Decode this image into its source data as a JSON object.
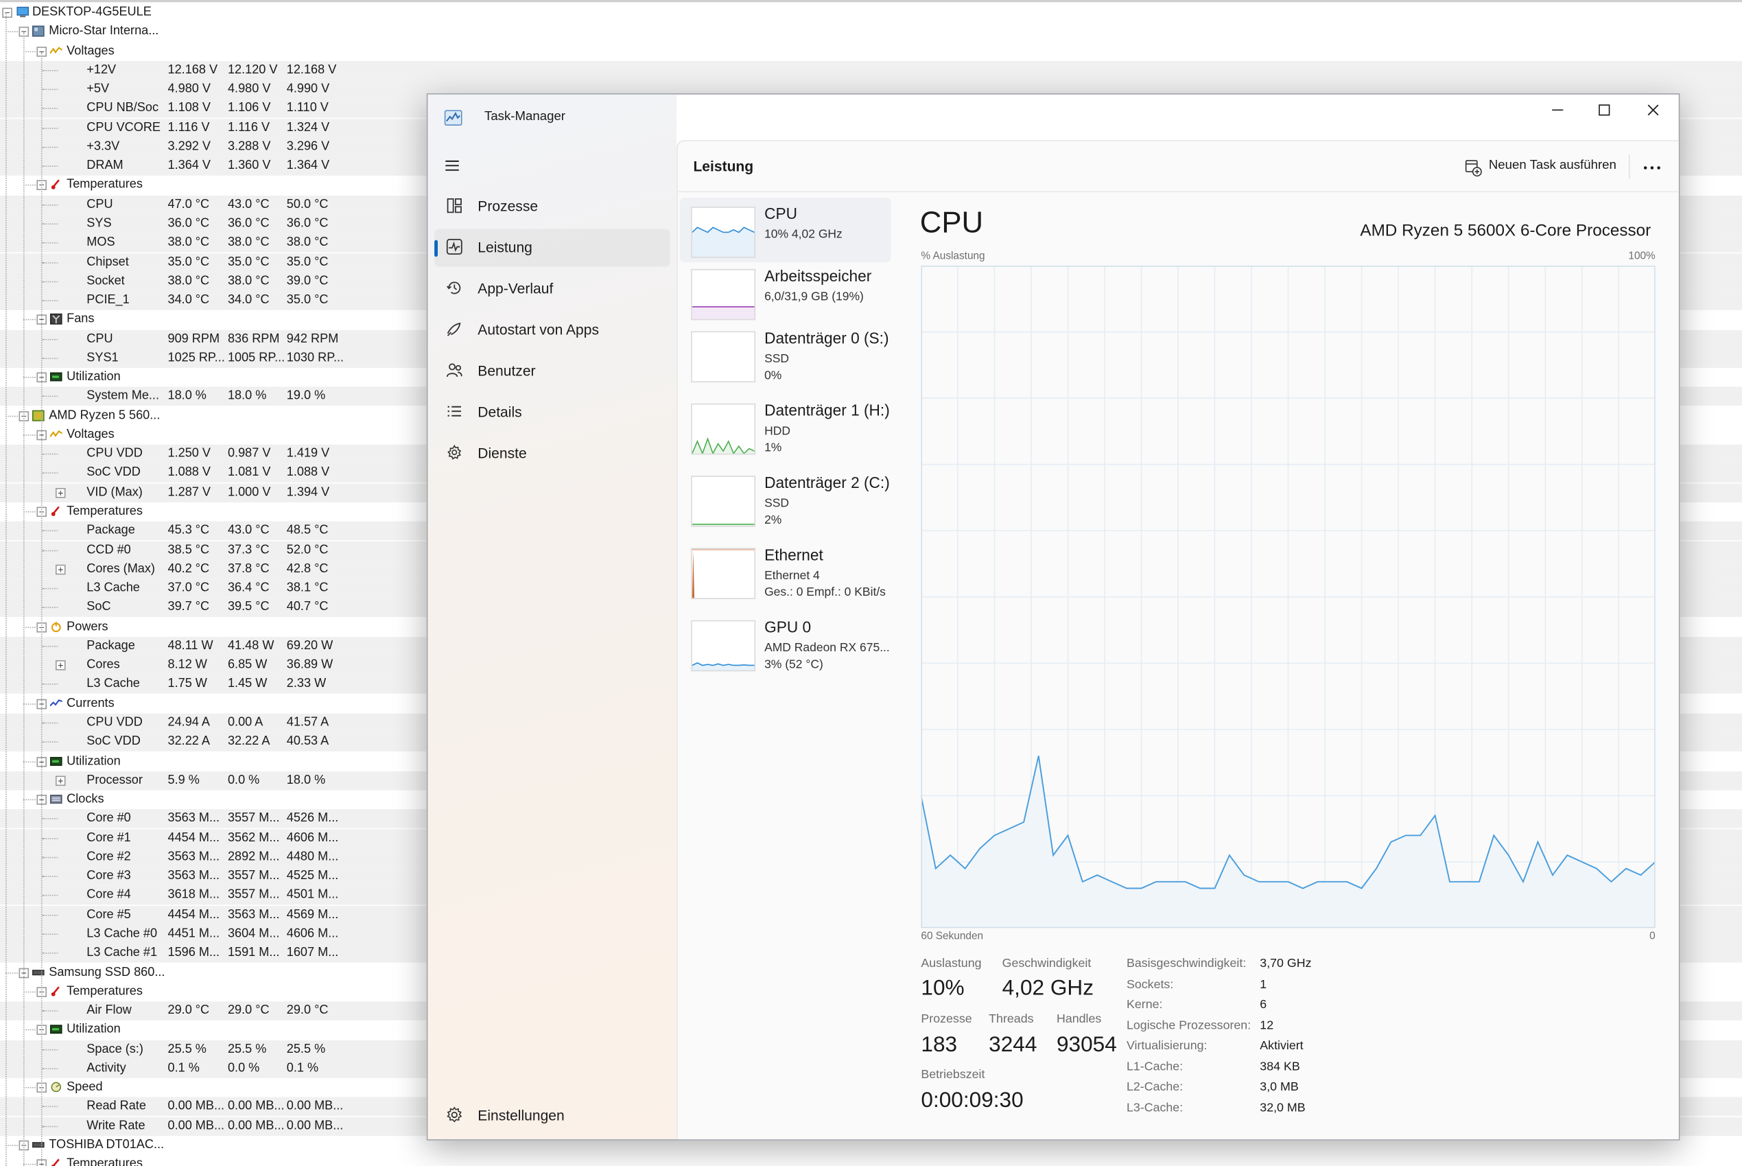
{
  "hwmonitor": {
    "root": "DESKTOP-4G5EULE",
    "rows": [
      {
        "t": "group",
        "d": 1,
        "label": "Micro-Star Interna...",
        "icon": "motherboard-icon"
      },
      {
        "t": "cat",
        "d": 2,
        "label": "Voltages",
        "icon": "voltage-icon"
      },
      {
        "t": "val",
        "label": "+12V",
        "v": [
          "12.168 V",
          "12.120 V",
          "12.168 V"
        ]
      },
      {
        "t": "val",
        "label": "+5V",
        "v": [
          "4.980 V",
          "4.980 V",
          "4.990 V"
        ]
      },
      {
        "t": "val",
        "label": "CPU NB/Soc",
        "v": [
          "1.108 V",
          "1.106 V",
          "1.110 V"
        ]
      },
      {
        "t": "val",
        "label": "CPU VCORE",
        "v": [
          "1.116 V",
          "1.116 V",
          "1.324 V"
        ]
      },
      {
        "t": "val",
        "label": "+3.3V",
        "v": [
          "3.292 V",
          "3.288 V",
          "3.296 V"
        ]
      },
      {
        "t": "val",
        "label": "DRAM",
        "v": [
          "1.364 V",
          "1.360 V",
          "1.364 V"
        ]
      },
      {
        "t": "cat",
        "d": 2,
        "label": "Temperatures",
        "icon": "thermometer-icon"
      },
      {
        "t": "val",
        "label": "CPU",
        "v": [
          "47.0 °C",
          "43.0 °C",
          "50.0 °C"
        ]
      },
      {
        "t": "val",
        "label": "SYS",
        "v": [
          "36.0 °C",
          "36.0 °C",
          "36.0 °C"
        ]
      },
      {
        "t": "val",
        "label": "MOS",
        "v": [
          "38.0 °C",
          "38.0 °C",
          "38.0 °C"
        ]
      },
      {
        "t": "val",
        "label": "Chipset",
        "v": [
          "35.0 °C",
          "35.0 °C",
          "35.0 °C"
        ]
      },
      {
        "t": "val",
        "label": "Socket",
        "v": [
          "38.0 °C",
          "38.0 °C",
          "39.0 °C"
        ]
      },
      {
        "t": "val",
        "label": "PCIE_1",
        "v": [
          "34.0 °C",
          "34.0 °C",
          "35.0 °C"
        ]
      },
      {
        "t": "cat",
        "d": 2,
        "label": "Fans",
        "icon": "fan-icon"
      },
      {
        "t": "val",
        "label": "CPU",
        "v": [
          "909 RPM",
          "836 RPM",
          "942 RPM"
        ]
      },
      {
        "t": "val",
        "label": "SYS1",
        "v": [
          "1025 RP...",
          "1005 RP...",
          "1030 RP..."
        ]
      },
      {
        "t": "cat",
        "d": 2,
        "label": "Utilization",
        "icon": "utilization-icon"
      },
      {
        "t": "val",
        "label": "System Me...",
        "v": [
          "18.0 %",
          "18.0 %",
          "19.0 %"
        ]
      },
      {
        "t": "group",
        "d": 1,
        "label": "AMD Ryzen 5 560...",
        "icon": "cpu-chip-icon"
      },
      {
        "t": "cat",
        "d": 2,
        "label": "Voltages",
        "icon": "voltage-icon"
      },
      {
        "t": "val",
        "label": "CPU VDD",
        "v": [
          "1.250 V",
          "0.987 V",
          "1.419 V"
        ]
      },
      {
        "t": "val",
        "label": "SoC VDD",
        "v": [
          "1.088 V",
          "1.081 V",
          "1.088 V"
        ]
      },
      {
        "t": "val",
        "label": "VID (Max)",
        "v": [
          "1.287 V",
          "1.000 V",
          "1.394 V"
        ],
        "exp": true
      },
      {
        "t": "cat",
        "d": 2,
        "label": "Temperatures",
        "icon": "thermometer-icon"
      },
      {
        "t": "val",
        "label": "Package",
        "v": [
          "45.3 °C",
          "43.0 °C",
          "48.5 °C"
        ]
      },
      {
        "t": "val",
        "label": "CCD #0",
        "v": [
          "38.5 °C",
          "37.3 °C",
          "52.0 °C"
        ]
      },
      {
        "t": "val",
        "label": "Cores (Max)",
        "v": [
          "40.2 °C",
          "37.8 °C",
          "42.8 °C"
        ],
        "exp": true
      },
      {
        "t": "val",
        "label": "L3 Cache",
        "v": [
          "37.0 °C",
          "36.4 °C",
          "38.1 °C"
        ]
      },
      {
        "t": "val",
        "label": "SoC",
        "v": [
          "39.7 °C",
          "39.5 °C",
          "40.7 °C"
        ]
      },
      {
        "t": "cat",
        "d": 2,
        "label": "Powers",
        "icon": "power-icon"
      },
      {
        "t": "val",
        "label": "Package",
        "v": [
          "48.11 W",
          "41.48 W",
          "69.20 W"
        ]
      },
      {
        "t": "val",
        "label": "Cores",
        "v": [
          "8.12 W",
          "6.85 W",
          "36.89 W"
        ],
        "exp": true
      },
      {
        "t": "val",
        "label": "L3 Cache",
        "v": [
          "1.75 W",
          "1.45 W",
          "2.33 W"
        ]
      },
      {
        "t": "cat",
        "d": 2,
        "label": "Currents",
        "icon": "current-icon"
      },
      {
        "t": "val",
        "label": "CPU VDD",
        "v": [
          "24.94 A",
          "0.00 A",
          "41.57 A"
        ]
      },
      {
        "t": "val",
        "label": "SoC VDD",
        "v": [
          "32.22 A",
          "32.22 A",
          "40.53 A"
        ]
      },
      {
        "t": "cat",
        "d": 2,
        "label": "Utilization",
        "icon": "utilization-icon"
      },
      {
        "t": "val",
        "label": "Processor",
        "v": [
          "5.9 %",
          "0.0 %",
          "18.0 %"
        ],
        "exp": true
      },
      {
        "t": "cat",
        "d": 2,
        "label": "Clocks",
        "icon": "clock-icon"
      },
      {
        "t": "val",
        "label": "Core #0",
        "v": [
          "3563 M...",
          "3557 M...",
          "4526 M..."
        ]
      },
      {
        "t": "val",
        "label": "Core #1",
        "v": [
          "4454 M...",
          "3562 M...",
          "4606 M..."
        ]
      },
      {
        "t": "val",
        "label": "Core #2",
        "v": [
          "3563 M...",
          "2892 M...",
          "4480 M..."
        ]
      },
      {
        "t": "val",
        "label": "Core #3",
        "v": [
          "3563 M...",
          "3557 M...",
          "4525 M..."
        ]
      },
      {
        "t": "val",
        "label": "Core #4",
        "v": [
          "3618 M...",
          "3557 M...",
          "4501 M..."
        ]
      },
      {
        "t": "val",
        "label": "Core #5",
        "v": [
          "4454 M...",
          "3563 M...",
          "4569 M..."
        ]
      },
      {
        "t": "val",
        "label": "L3 Cache #0",
        "v": [
          "4451 M...",
          "3604 M...",
          "4606 M..."
        ]
      },
      {
        "t": "val",
        "label": "L3 Cache #1",
        "v": [
          "1596 M...",
          "1591 M...",
          "1607 M..."
        ]
      },
      {
        "t": "group",
        "d": 1,
        "label": "Samsung SSD 860...",
        "icon": "drive-icon"
      },
      {
        "t": "cat",
        "d": 2,
        "label": "Temperatures",
        "icon": "thermometer-icon"
      },
      {
        "t": "val",
        "label": "Air Flow",
        "v": [
          "29.0 °C",
          "29.0 °C",
          "29.0 °C"
        ]
      },
      {
        "t": "cat",
        "d": 2,
        "label": "Utilization",
        "icon": "utilization-icon"
      },
      {
        "t": "val",
        "label": "Space (s:)",
        "v": [
          "25.5 %",
          "25.5 %",
          "25.5 %"
        ]
      },
      {
        "t": "val",
        "label": "Activity",
        "v": [
          "0.1 %",
          "0.0 %",
          "0.1 %"
        ]
      },
      {
        "t": "cat",
        "d": 2,
        "label": "Speed",
        "icon": "speed-icon"
      },
      {
        "t": "val",
        "label": "Read Rate",
        "v": [
          "0.00 MB...",
          "0.00 MB...",
          "0.00 MB..."
        ]
      },
      {
        "t": "val",
        "label": "Write Rate",
        "v": [
          "0.00 MB...",
          "0.00 MB...",
          "0.00 MB..."
        ]
      },
      {
        "t": "group",
        "d": 1,
        "label": "TOSHIBA DT01AC...",
        "icon": "drive-icon"
      },
      {
        "t": "cat",
        "d": 2,
        "label": "Temperatures",
        "icon": "thermometer-icon"
      }
    ]
  },
  "taskmanager": {
    "title": "Task-Manager",
    "nav": [
      {
        "label": "Prozesse",
        "icon": "processes-icon"
      },
      {
        "label": "Leistung",
        "icon": "performance-icon",
        "selected": true
      },
      {
        "label": "App-Verlauf",
        "icon": "history-icon"
      },
      {
        "label": "Autostart von Apps",
        "icon": "startup-icon"
      },
      {
        "label": "Benutzer",
        "icon": "users-icon"
      },
      {
        "label": "Details",
        "icon": "details-icon"
      },
      {
        "label": "Dienste",
        "icon": "services-icon"
      }
    ],
    "settings": "Einstellungen",
    "content_title": "Leistung",
    "new_task": "Neuen Task ausführen",
    "devices": [
      {
        "name": "CPU",
        "l1": "10%  4,02 GHz",
        "l2": "",
        "color": "#2e8bd6",
        "spark": "cpu",
        "selected": true
      },
      {
        "name": "Arbeitsspeicher",
        "l1": "6,0/31,9 GB (19%)",
        "l2": "",
        "color": "#9b3fb3",
        "spark": "mem"
      },
      {
        "name": "Datenträger 0 (S:)",
        "l1": "SSD",
        "l2": "0%",
        "color": "#4caf50",
        "spark": "none"
      },
      {
        "name": "Datenträger 1 (H:)",
        "l1": "HDD",
        "l2": "1%",
        "color": "#4caf50",
        "spark": "hdd"
      },
      {
        "name": "Datenträger 2 (C:)",
        "l1": "SSD",
        "l2": "2%",
        "color": "#4caf50",
        "spark": "flat"
      },
      {
        "name": "Ethernet",
        "l1": "Ethernet 4",
        "l2": "Ges.: 0  Empf.: 0 KBit/s",
        "color": "#c8692f",
        "spark": "eth"
      },
      {
        "name": "GPU 0",
        "l1": "AMD Radeon RX 675...",
        "l2": "3%  (52 °C)",
        "color": "#2e8bd6",
        "spark": "gpu"
      }
    ],
    "detail": {
      "heading": "CPU",
      "model": "AMD Ryzen 5 5600X 6-Core Processor",
      "ylabel": "% Auslastung",
      "ymax_label": "100%",
      "xlabel": "60 Sekunden",
      "xmin_label": "0",
      "stats": {
        "util_label": "Auslastung",
        "util": "10%",
        "speed_label": "Geschwindigkeit",
        "speed": "4,02 GHz",
        "proc_label": "Prozesse",
        "proc": "183",
        "threads_label": "Threads",
        "threads": "3244",
        "handles_label": "Handles",
        "handles": "93054",
        "uptime_label": "Betriebszeit",
        "uptime": "0:00:09:30"
      },
      "specs": [
        [
          "Basisgeschwindigkeit:",
          "3,70 GHz"
        ],
        [
          "Sockets:",
          "1"
        ],
        [
          "Kerne:",
          "6"
        ],
        [
          "Logische Prozessoren:",
          "12"
        ],
        [
          "Virtualisierung:",
          "Aktiviert"
        ],
        [
          "L1-Cache:",
          "384 KB"
        ],
        [
          "L2-Cache:",
          "3,0 MB"
        ],
        [
          "L3-Cache:",
          "32,0 MB"
        ]
      ]
    },
    "chart_data": {
      "type": "area",
      "ylim": [
        0,
        100
      ],
      "xlabel": "60 Sekunden",
      "ylabel": "% Auslastung",
      "series": [
        {
          "values": [
            20,
            9,
            11,
            9,
            12,
            14,
            15,
            16,
            26,
            11,
            14,
            7,
            8,
            7,
            6,
            6,
            7,
            7,
            7,
            6,
            6,
            11,
            8,
            7,
            7,
            7,
            6,
            7,
            7,
            7,
            6,
            9,
            13,
            14,
            14,
            17,
            7,
            7,
            7,
            14,
            11,
            7,
            13,
            8,
            11,
            10,
            9,
            7,
            9,
            8,
            10
          ]
        }
      ]
    },
    "colors": {
      "accent": "#0067c0",
      "cpu_line": "#4a9edd",
      "cpu_fill": "#f0f5fa"
    }
  }
}
